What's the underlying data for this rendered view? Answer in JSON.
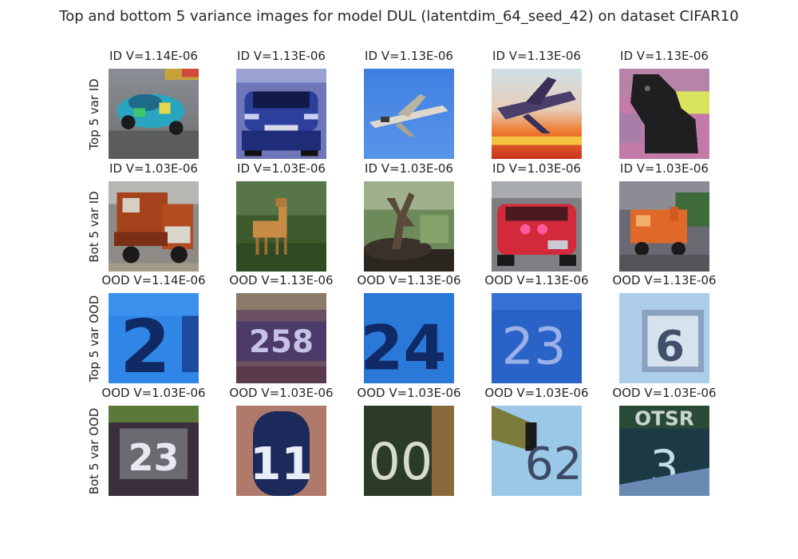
{
  "chart_data": {
    "type": "image-grid",
    "title": "Top and bottom 5 variance images for model DUL (latentdim_64_seed_42) on dataset CIFAR10",
    "rows": [
      {
        "label": "Top 5 var ID",
        "captions": [
          "ID V=1.14E-06",
          "ID V=1.13E-06",
          "ID V=1.13E-06",
          "ID V=1.13E-06",
          "ID V=1.13E-06"
        ],
        "images": [
          "race-car",
          "blue-car-front",
          "airplane-blue-sky",
          "airplane-sunset",
          "black-dog"
        ],
        "variance": [
          1.14e-06,
          1.13e-06,
          1.13e-06,
          1.13e-06,
          1.13e-06
        ]
      },
      {
        "label": "Bot 5 var ID",
        "captions": [
          "ID V=1.03E-06",
          "ID V=1.03E-06",
          "ID V=1.03E-06",
          "ID V=1.03E-06",
          "ID V=1.03E-06"
        ],
        "images": [
          "red-truck",
          "deer",
          "tree-shade",
          "red-car-rear",
          "orange-truck"
        ],
        "variance": [
          1.03e-06,
          1.03e-06,
          1.03e-06,
          1.03e-06,
          1.03e-06
        ]
      },
      {
        "label": "Top 5 var OOD",
        "captions": [
          "OOD V=1.14E-06",
          "OOD V=1.13E-06",
          "OOD V=1.13E-06",
          "OOD V=1.13E-06",
          "OOD V=1.13E-06"
        ],
        "images": [
          "digit-2",
          "digit-258",
          "digit-24",
          "digit-23",
          "digit-6"
        ],
        "variance": [
          1.14e-06,
          1.13e-06,
          1.13e-06,
          1.13e-06,
          1.13e-06
        ]
      },
      {
        "label": "Bot 5 var OOD",
        "captions": [
          "OOD V=1.03E-06",
          "OOD V=1.03E-06",
          "OOD V=1.03E-06",
          "OOD V=1.03E-06",
          "OOD V=1.03E-06"
        ],
        "images": [
          "digit-23-dark",
          "digit-11",
          "digit-00",
          "digit-62",
          "digit-3"
        ],
        "variance": [
          1.03e-06,
          1.03e-06,
          1.03e-06,
          1.03e-06,
          1.03e-06
        ]
      }
    ]
  }
}
